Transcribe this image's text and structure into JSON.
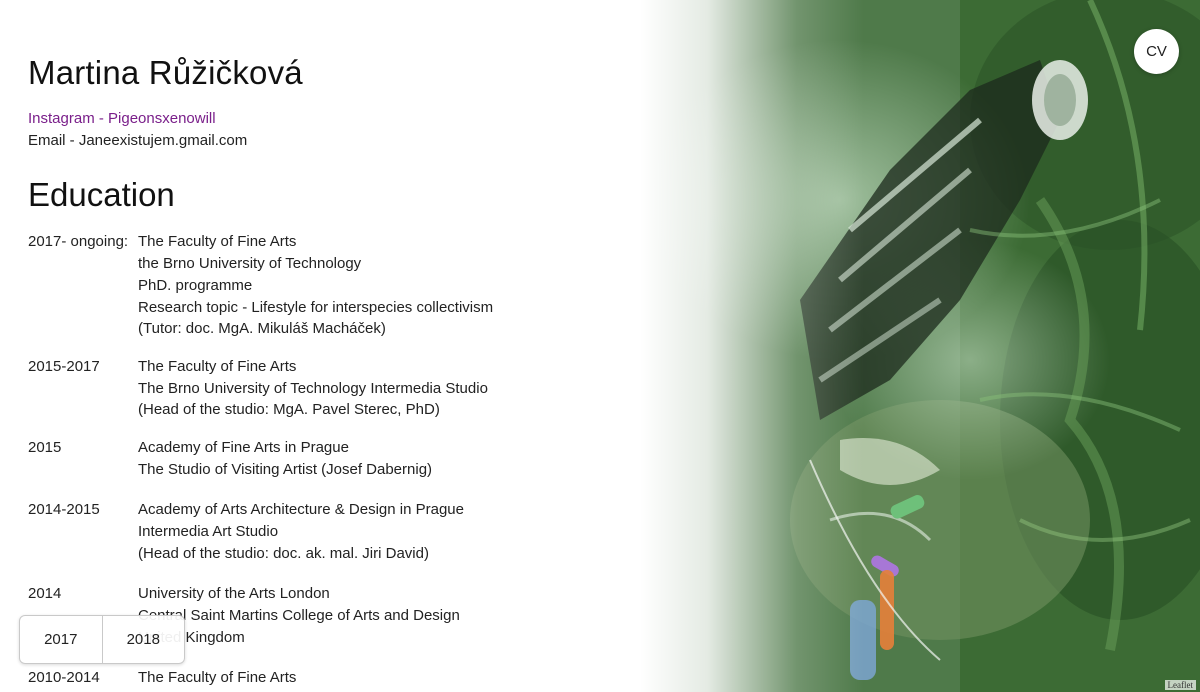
{
  "profile": {
    "name": "Martina Růžičková",
    "instagram": "Instagram - Pigeonsxenowill",
    "email": "Email - Janeexistujem.gmail.com"
  },
  "education": {
    "title": "Education",
    "entries": [
      {
        "year": "2017- ongoing:",
        "lines": [
          "The Faculty of Fine Arts",
          "the Brno University of Technology",
          "PhD. programme",
          "Research topic - Lifestyle for interspecies collectivism",
          "(Tutor: doc. MgA. Mikuláš Macháček)"
        ]
      },
      {
        "year": "2015-2017",
        "lines": [
          "The Faculty of Fine Arts",
          "The Brno University of Technology Intermedia Studio",
          "(Head of the studio: MgA. Pavel Sterec, PhD)"
        ]
      },
      {
        "year": "2015",
        "lines": [
          "Academy of Fine Arts in Prague",
          "The Studio of Visiting Artist (Josef Dabernig)"
        ]
      },
      {
        "year": "2014-2015",
        "lines": [
          "Academy of Arts Architecture & Design in Prague",
          "Intermedia Art Studio",
          "(Head of the studio: doc. ak. mal. Jiri David)"
        ]
      },
      {
        "year": "2014",
        "lines": [
          "University of the Arts London",
          "Central Saint Martins College of Arts and Design",
          "United Kingdom"
        ]
      },
      {
        "year": "2010-2014",
        "lines": [
          "The Faculty of Fine Arts"
        ]
      }
    ]
  },
  "cv_button": {
    "label": "CV"
  },
  "year_selector": {
    "options": [
      "2017",
      "2018"
    ]
  },
  "map_attribution": "Leaflet",
  "colors": {
    "instagram_link": "#7a1f8a",
    "background": "#ffffff"
  }
}
